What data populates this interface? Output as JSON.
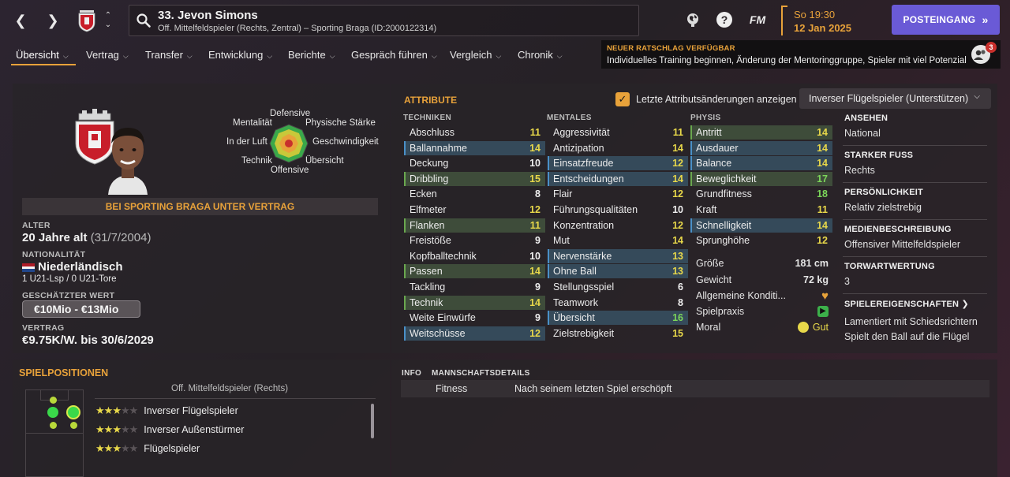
{
  "header": {
    "player_title": "33. Jevon Simons",
    "player_desc": "Off. Mittelfeldspieler (Rechts, Zentral) – Sporting Braga (ID:2000122314)",
    "fm_label": "FM",
    "date_line1": "So 19:30",
    "date_line2": "12 Jan 2025",
    "inbox_label": "POSTEINGANG",
    "accent": "#e8a23a",
    "inbox_color": "#6a5ad6"
  },
  "menu": [
    {
      "label": "Übersicht"
    },
    {
      "label": "Vertrag"
    },
    {
      "label": "Transfer"
    },
    {
      "label": "Entwicklung"
    },
    {
      "label": "Berichte"
    },
    {
      "label": "Gespräch führen"
    },
    {
      "label": "Vergleich"
    },
    {
      "label": "Chronik"
    }
  ],
  "advice": {
    "heading": "NEUER RATSCHLAG VERFÜGBAR",
    "text": "Individuelles Training beginnen, Änderung der Mentoringgruppe, Spieler mit viel Potenzial",
    "badge": "3"
  },
  "profile": {
    "radar_labels": {
      "defensive": "Defensive",
      "physical": "Physische Stärke",
      "speed": "Geschwindigkeit",
      "vision": "Übersicht",
      "attacking": "Offensive",
      "technique": "Technik",
      "aerial": "In der Luft",
      "mental": "Mentalität"
    },
    "contract_banner": "BEI SPORTING BRAGA UNTER VERTRAG",
    "age_label": "ALTER",
    "age_value": "20 Jahre alt",
    "age_dob": "(31/7/2004)",
    "nat_label": "NATIONALITÄT",
    "nat_value": "Niederländisch",
    "nat_caps": "1 U21-Lsp / 0 U21-Tore",
    "value_label": "GESCHÄTZTER WERT",
    "value_amount": "€10Mio - €13Mio",
    "contract_label": "VERTRAG",
    "contract_value": "€9.75K/W. bis 30/6/2029"
  },
  "attributes": {
    "title": "ATTRIBUTE",
    "checkbox_label": "Letzte Attributsänderungen anzeigen",
    "role_dropdown": "Inverser Flügelspieler (Unterstützen)",
    "technical_head": "TECHNIKEN",
    "mental_head": "MENTALES",
    "physical_head": "PHYSIS",
    "technical": [
      {
        "name": "Abschluss",
        "value": "11",
        "hl": ""
      },
      {
        "name": "Ballannahme",
        "value": "14",
        "hl": "blue"
      },
      {
        "name": "Deckung",
        "value": "10",
        "hl": ""
      },
      {
        "name": "Dribbling",
        "value": "15",
        "hl": "green"
      },
      {
        "name": "Ecken",
        "value": "8",
        "hl": ""
      },
      {
        "name": "Elfmeter",
        "value": "12",
        "hl": ""
      },
      {
        "name": "Flanken",
        "value": "11",
        "hl": "green"
      },
      {
        "name": "Freistöße",
        "value": "9",
        "hl": ""
      },
      {
        "name": "Kopfballtechnik",
        "value": "10",
        "hl": ""
      },
      {
        "name": "Passen",
        "value": "14",
        "hl": "green"
      },
      {
        "name": "Tackling",
        "value": "9",
        "hl": ""
      },
      {
        "name": "Technik",
        "value": "14",
        "hl": "green"
      },
      {
        "name": "Weite Einwürfe",
        "value": "9",
        "hl": ""
      },
      {
        "name": "Weitschüsse",
        "value": "12",
        "hl": "blue"
      }
    ],
    "mental": [
      {
        "name": "Aggressivität",
        "value": "11",
        "hl": ""
      },
      {
        "name": "Antizipation",
        "value": "14",
        "hl": ""
      },
      {
        "name": "Einsatzfreude",
        "value": "12",
        "hl": "blue"
      },
      {
        "name": "Entscheidungen",
        "value": "14",
        "hl": "blue"
      },
      {
        "name": "Flair",
        "value": "12",
        "hl": ""
      },
      {
        "name": "Führungsqualitäten",
        "value": "10",
        "hl": ""
      },
      {
        "name": "Konzentration",
        "value": "12",
        "hl": ""
      },
      {
        "name": "Mut",
        "value": "14",
        "hl": ""
      },
      {
        "name": "Nervenstärke",
        "value": "13",
        "hl": "blue"
      },
      {
        "name": "Ohne Ball",
        "value": "13",
        "hl": "blue"
      },
      {
        "name": "Stellungsspiel",
        "value": "6",
        "hl": ""
      },
      {
        "name": "Teamwork",
        "value": "8",
        "hl": ""
      },
      {
        "name": "Übersicht",
        "value": "16",
        "hl": "blue"
      },
      {
        "name": "Zielstrebigkeit",
        "value": "15",
        "hl": ""
      }
    ],
    "physical": [
      {
        "name": "Antritt",
        "value": "14",
        "hl": "green"
      },
      {
        "name": "Ausdauer",
        "value": "14",
        "hl": "blue"
      },
      {
        "name": "Balance",
        "value": "14",
        "hl": "blue"
      },
      {
        "name": "Beweglichkeit",
        "value": "17",
        "hl": "green"
      },
      {
        "name": "Grundfitness",
        "value": "18",
        "hl": ""
      },
      {
        "name": "Kraft",
        "value": "11",
        "hl": ""
      },
      {
        "name": "Schnelligkeit",
        "value": "14",
        "hl": "blue"
      },
      {
        "name": "Sprunghöhe",
        "value": "12",
        "hl": ""
      }
    ],
    "stats": {
      "height_label": "Größe",
      "height_value": "181 cm",
      "weight_label": "Gewicht",
      "weight_value": "72 kg",
      "condition_label": "Allgemeine Konditi...",
      "match_label": "Spielpraxis",
      "morale_label": "Moral",
      "morale_value": "Gut"
    }
  },
  "info_right": {
    "reputation_label": "ANSEHEN",
    "reputation_value": "National",
    "foot_label": "STARKER FUSS",
    "foot_value": "Rechts",
    "personality_label": "PERSÖNLICHKEIT",
    "personality_value": "Relativ zielstrebig",
    "media_label": "MEDIENBESCHREIBUNG",
    "media_value": "Offensiver Mittelfeldspieler",
    "gk_label": "TORWARTWERTUNG",
    "gk_value": "3",
    "traits_label": "SPIELEREIGENSCHAFTEN",
    "traits": [
      "Lamentiert mit Schiedsrichtern",
      "Spielt den Ball auf die Flügel"
    ]
  },
  "positions": {
    "title": "SPIELPOSITIONEN",
    "subtitle": "Off. Mittelfeldspieler (Rechts)",
    "roles": [
      {
        "name": "Inverser Flügelspieler",
        "stars": 2.5
      },
      {
        "name": "Inverser Außenstürmer",
        "stars": 2.5
      },
      {
        "name": "Flügelspieler",
        "stars": 2.5
      }
    ]
  },
  "bottom_info": {
    "tab_info": "INFO",
    "tab_team": "MANNSCHAFTSDETAILS",
    "fitness_label": "Fitness",
    "fitness_value": "Nach seinem letzten Spiel erschöpft"
  }
}
